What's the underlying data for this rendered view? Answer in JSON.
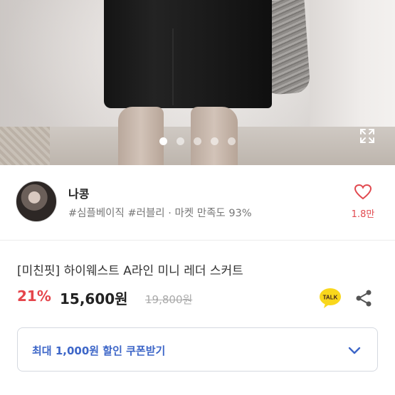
{
  "seller": {
    "name": "나콩",
    "tags": "#심플베이직 #러블리 · 마켓 만족도 93%",
    "likes": "1.8만"
  },
  "gallery": {
    "dot_count": 5,
    "active_index": 0
  },
  "product": {
    "title": "[미친핏] 하이웨스트 A라인 미니 레더 스커트",
    "discount": "21%",
    "price": "15,600원",
    "original_price": "19,800원"
  },
  "actions": {
    "talk_label": "TALK"
  },
  "coupon": {
    "label": "최대 1,000원 할인 쿠폰받기"
  },
  "colors": {
    "accent_red": "#e5454b",
    "coupon_blue": "#3d66c8",
    "talk_yellow": "#f9d71c"
  }
}
